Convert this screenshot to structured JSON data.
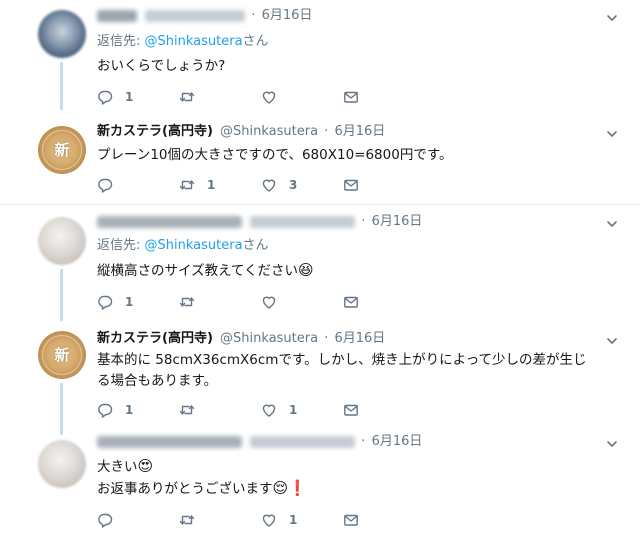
{
  "tweets": [
    {
      "name": "",
      "handle": "",
      "dot": "·",
      "time": "6月16日",
      "replying_prefix": "返信先: ",
      "replying_mention": "@Shinkasutera",
      "replying_suffix": "さん",
      "lines": [
        "おいくらでしょうか?"
      ],
      "reply_count": "1",
      "retweet_count": "",
      "like_count": ""
    },
    {
      "name": "新カステラ(高円寺)",
      "handle": "@Shinkasutera",
      "dot": "·",
      "time": "6月16日",
      "lines": [
        "プレーン10個の大きさですので、680X10=6800円です。"
      ],
      "reply_count": "",
      "retweet_count": "1",
      "like_count": "3",
      "avatar_kanji": "新"
    },
    {
      "name": "",
      "handle": "",
      "dot": "·",
      "time": "6月16日",
      "replying_prefix": "返信先: ",
      "replying_mention": "@Shinkasutera",
      "replying_suffix": "さん",
      "lines": [
        "縦横高さのサイズ教えてください"
      ],
      "emoji": "😆",
      "reply_count": "1",
      "retweet_count": "",
      "like_count": ""
    },
    {
      "name": "新カステラ(高円寺)",
      "handle": "@Shinkasutera",
      "dot": "·",
      "time": "6月16日",
      "lines": [
        "基本的に 58cmX36cmX6cmです。しかし、焼き上がりによって少しの差が生じ",
        "る場合もあります。"
      ],
      "reply_count": "1",
      "retweet_count": "",
      "like_count": "1",
      "avatar_kanji": "新"
    },
    {
      "name": "",
      "handle": "",
      "dot": "·",
      "time": "6月16日",
      "line1": "大きい",
      "line1_emoji": "😍",
      "line2": "お返事ありがとうございます",
      "line2_emoji": "😌",
      "line2_emoji2": "❗",
      "reply_count": "",
      "retweet_count": "",
      "like_count": "1"
    }
  ],
  "colors": {
    "link": "#1da1f2",
    "muted": "#657786",
    "thread_line": "#c4dfef",
    "divider": "#e6ecf0"
  },
  "icons": [
    "reply-icon",
    "retweet-icon",
    "like-icon",
    "dm-icon",
    "chevron-down-icon"
  ]
}
